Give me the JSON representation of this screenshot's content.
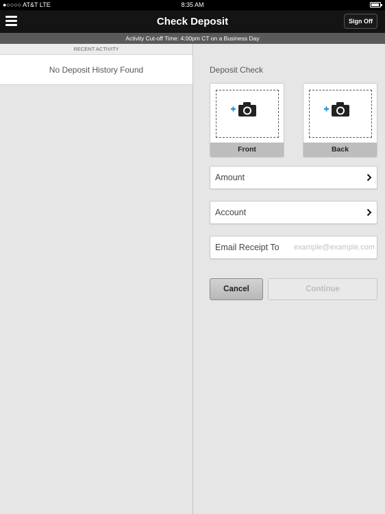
{
  "status_bar": {
    "carrier": "●○○○○ AT&T  LTE",
    "time": "8:35 AM"
  },
  "header": {
    "title": "Check Deposit",
    "signoff_label": "Sign Off"
  },
  "notice": {
    "cutoff_text": "Activity Cut-off Time: 4:00pm CT on a Business Day"
  },
  "recent_activity": {
    "header": "RECENT ACTIVITY",
    "empty_message": "No Deposit History Found"
  },
  "deposit_form": {
    "title": "Deposit Check",
    "front_label": "Front",
    "back_label": "Back",
    "amount_label": "Amount",
    "account_label": "Account",
    "email_label": "Email Receipt To",
    "email_value": "",
    "email_placeholder": "example@example.com",
    "cancel_label": "Cancel",
    "continue_label": "Continue"
  },
  "colors": {
    "accent_plus": "#1f8fd6",
    "nav_background": "#141414",
    "notice_background": "#5a5a5a"
  }
}
